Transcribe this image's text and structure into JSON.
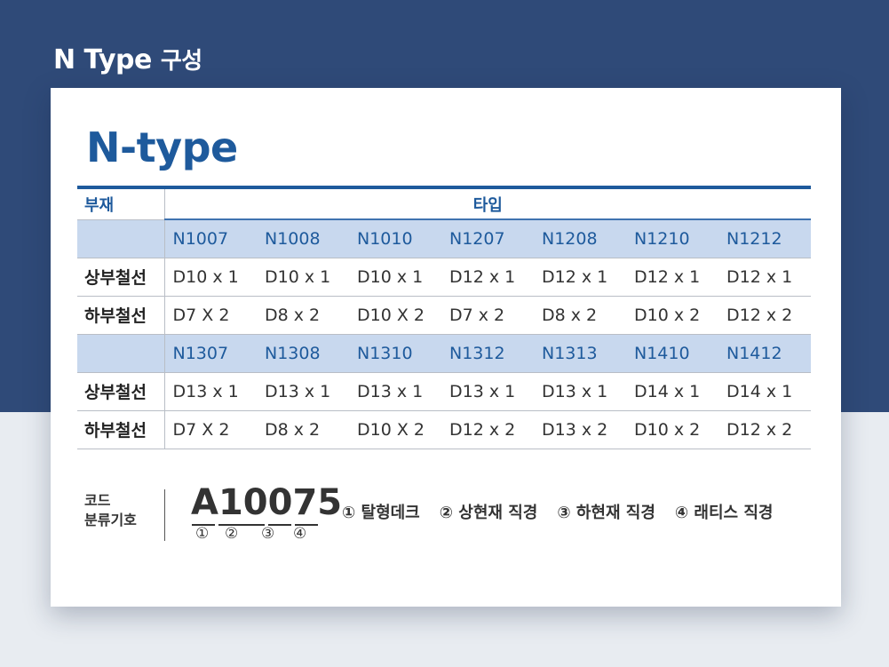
{
  "section_title": {
    "en": "N Type",
    "ko": "구성"
  },
  "card_title": "N-type",
  "table": {
    "col_label": "부재",
    "type_label": "타입",
    "groups": [
      {
        "codes": [
          "N1007",
          "N1008",
          "N1010",
          "N1207",
          "N1208",
          "N1210",
          "N1212"
        ],
        "rows": [
          {
            "label": "상부철선",
            "values": [
              "D10 x 1",
              "D10 x 1",
              "D10 x 1",
              "D12 x 1",
              "D12 x 1",
              "D12 x 1",
              "D12 x 1"
            ]
          },
          {
            "label": "하부철선",
            "values": [
              "D7 X 2",
              "D8 x 2",
              "D10 X 2",
              "D7 x 2",
              "D8 x 2",
              "D10 x 2",
              "D12 x 2"
            ]
          }
        ]
      },
      {
        "codes": [
          "N1307",
          "N1308",
          "N1310",
          "N1312",
          "N1313",
          "N1410",
          "N1412"
        ],
        "rows": [
          {
            "label": "상부철선",
            "values": [
              "D13 x 1",
              "D13 x 1",
              "D13 x 1",
              "D13 x 1",
              "D13 x 1",
              "D14 x 1",
              "D14 x 1"
            ]
          },
          {
            "label": "하부철선",
            "values": [
              "D7 X 2",
              "D8 x 2",
              "D10 X 2",
              "D12 x 2",
              "D13 x 2",
              "D10 x 2",
              "D12 x 2"
            ]
          }
        ]
      }
    ]
  },
  "code_legend": {
    "label_line1": "코드",
    "label_line2": "분류기호",
    "code": "A10075",
    "markers": [
      "①",
      "②",
      "③",
      "④"
    ],
    "items": [
      "① 탈형데크",
      "② 상현재 직경",
      "③ 하현재 직경",
      "④ 래티스 직경"
    ]
  },
  "colors": {
    "navy": "#2f4a78",
    "accent": "#1e5a9c",
    "code_row_bg": "#c8d8ee"
  }
}
